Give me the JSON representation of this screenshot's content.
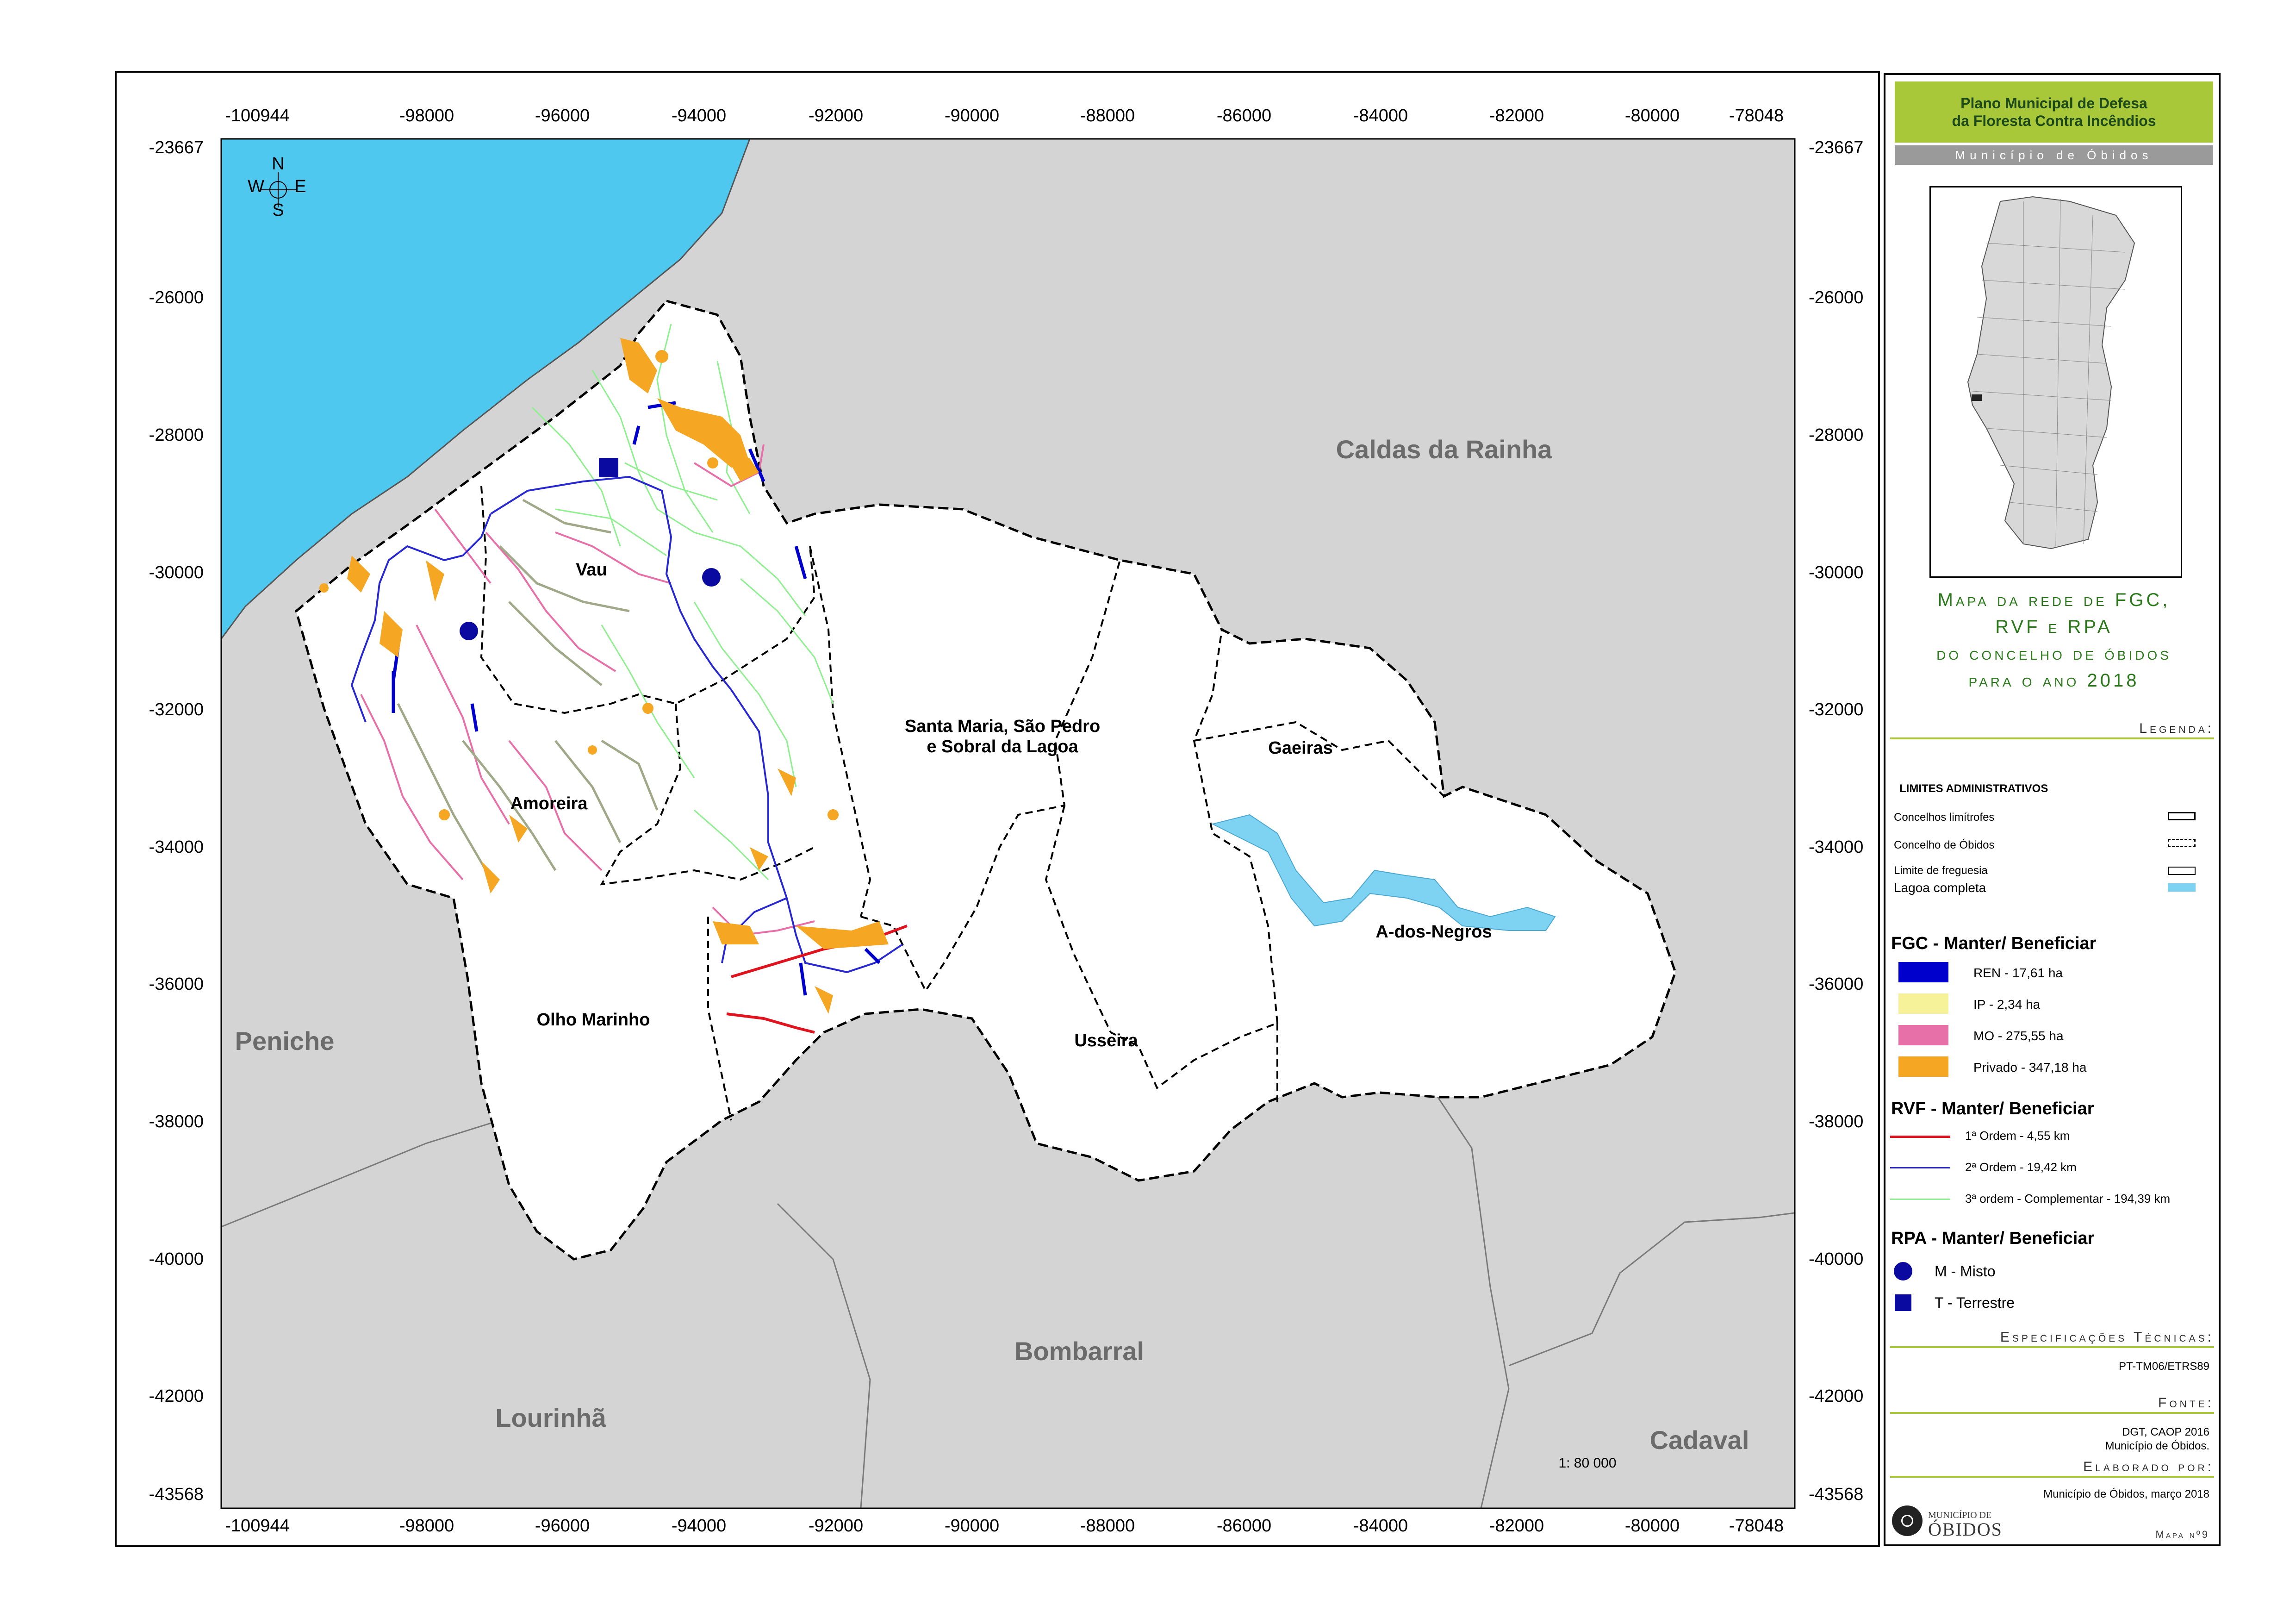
{
  "map": {
    "x_ticks": [
      "-100944",
      "-98000",
      "-96000",
      "-94000",
      "-92000",
      "-90000",
      "-88000",
      "-86000",
      "-84000",
      "-82000",
      "-80000",
      "-78048"
    ],
    "y_ticks": [
      "-23667",
      "-26000",
      "-28000",
      "-30000",
      "-32000",
      "-34000",
      "-36000",
      "-38000",
      "-40000",
      "-42000",
      "-43568"
    ],
    "neighbours": {
      "caldas": "Caldas da Rainha",
      "peniche": "Peniche",
      "bombarral": "Bombarral",
      "lourinha": "Lourinhã",
      "cadaval": "Cadaval"
    },
    "parishes": {
      "vau": "Vau",
      "amoreira": "Amoreira",
      "santa_maria_1": "Santa Maria, São Pedro",
      "santa_maria_2": "e Sobral da Lagoa",
      "gaeiras": "Gaeiras",
      "a_dos_negros": "A-dos-Negros",
      "olho_marinho": "Olho Marinho",
      "usseira": "Usseira"
    },
    "scale": "1: 80 000",
    "compass": {
      "n": "N",
      "s": "S",
      "e": "E",
      "w": "W"
    },
    "colors": {
      "sea": "#4fc8f0",
      "neighbour": "#d4d4d4",
      "parish": "#ffffff",
      "lagoon": "#7fd3f2",
      "ren": "#0000cc",
      "ip": "#f5f29a",
      "mo": "#e870a8",
      "privado": "#f5a623",
      "rvf1": "#e0141e",
      "rvf2": "#2828d0",
      "rvf3": "#8ef08e",
      "rpa": "#0a0aa0"
    }
  },
  "panel": {
    "title1": "Plano Municipal de Defesa",
    "title2": "da Floresta Contra Incêndios",
    "municipality": "Município de Óbidos",
    "map_title_1": "Mapa da rede de FGC,",
    "map_title_2": "RVF e RPA",
    "map_title_3": "do concelho de óbidos",
    "map_title_4": "para o ano 2018",
    "legend_header": "Legenda:",
    "admin": {
      "title": "LIMITES ADMINISTRATIVOS",
      "items": [
        "Concelhos limítrofes",
        "Concelho de Óbidos",
        "Limite de freguesia",
        "Lagoa completa"
      ]
    },
    "fgc": {
      "title": "FGC - Manter/ Beneficiar",
      "items": [
        "REN - 17,61 ha",
        "IP - 2,34 ha",
        "MO - 275,55 ha",
        "Privado - 347,18 ha"
      ]
    },
    "rvf": {
      "title": "RVF - Manter/ Beneficiar",
      "items": [
        "1ª Ordem - 4,55 km",
        "2ª Ordem - 19,42 km",
        "3ª ordem - Complementar - 194,39 km"
      ]
    },
    "rpa": {
      "title": "RPA - Manter/ Beneficiar",
      "items": [
        "M - Misto",
        "T - Terrestre"
      ]
    },
    "spec_header": "Especificações Técnicas:",
    "spec_value": "PT-TM06/ETRS89",
    "source_header": "Fonte:",
    "source_1": "DGT, CAOP 2016",
    "source_2": "Município de Óbidos.",
    "author_header": "Elaborado por:",
    "author_value": "Município de Óbidos, março 2018",
    "logo_1": "MUNICÍPIO DE",
    "logo_2": "ÓBIDOS",
    "map_number": "Mapa nº9"
  }
}
